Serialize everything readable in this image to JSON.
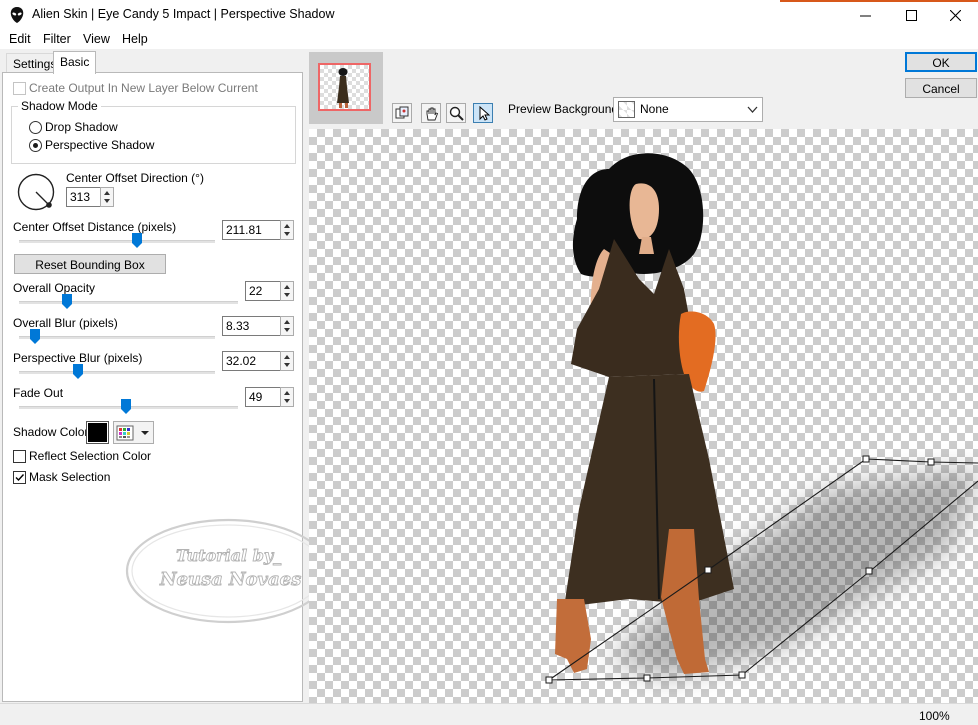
{
  "window": {
    "title": "Alien Skin | Eye Candy 5 Impact | Perspective Shadow"
  },
  "menu": [
    "Edit",
    "Filter",
    "View",
    "Help"
  ],
  "tabs": [
    "Settings",
    "Basic"
  ],
  "left_panel": {
    "create_output_label": "Create Output In New Layer Below Current",
    "shadow_mode_label": "Shadow Mode",
    "drop_shadow_label": "Drop Shadow",
    "perspective_shadow_label": "Perspective Shadow",
    "center_offset_direction_label": "Center Offset Direction (°)",
    "center_offset_direction_value": "313",
    "center_offset_distance_label": "Center Offset Distance (pixels)",
    "center_offset_distance_value": "211.81",
    "reset_bounding_box_label": "Reset Bounding Box",
    "overall_opacity_label": "Overall Opacity",
    "overall_opacity_value": "22",
    "overall_blur_label": "Overall Blur (pixels)",
    "overall_blur_value": "8.33",
    "perspective_blur_label": "Perspective Blur (pixels)",
    "perspective_blur_value": "32.02",
    "fade_out_label": "Fade Out",
    "fade_out_value": "49",
    "shadow_color_label": "Shadow Color",
    "shadow_color": "#000000",
    "reflect_selection_label": "Reflect Selection Color",
    "mask_selection_label": "Mask Selection",
    "reflect_selection_checked": false,
    "mask_selection_checked": true,
    "slider_levels": {
      "center_offset_distance": 0.6,
      "overall_opacity": 0.22,
      "overall_blur": 0.08,
      "perspective_blur": 0.3,
      "fade_out": 0.49
    }
  },
  "preview_toolbar": {
    "preview_background_label": "Preview Background:",
    "preview_background_value": "None"
  },
  "buttons": {
    "ok": "OK",
    "cancel": "Cancel"
  },
  "watermark": {
    "line1": "Tutorial by_",
    "line2": "Neusa Novaes"
  },
  "status": {
    "zoom": "100%"
  }
}
